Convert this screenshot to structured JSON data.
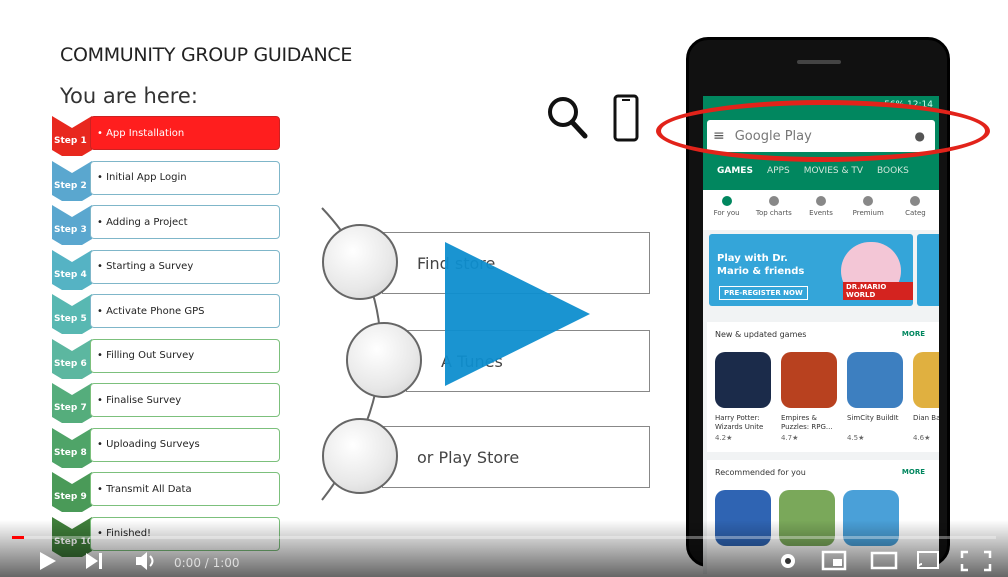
{
  "slide": {
    "title": "COMMUNITY GROUP GUIDANCE",
    "subtitle": "You are here:",
    "steps": [
      {
        "num": "Step 1",
        "label": "• App Installation",
        "color": "#e8281e",
        "state": "active"
      },
      {
        "num": "Step 2",
        "label": "• Initial App Login",
        "color": "#5aa7cf",
        "state": "blue"
      },
      {
        "num": "Step 3",
        "label": "• Adding a Project",
        "color": "#5aa7cf",
        "state": "blue"
      },
      {
        "num": "Step 4",
        "label": "• Starting a Survey",
        "color": "#55b3c4",
        "state": "blue"
      },
      {
        "num": "Step 5",
        "label": "• Activate Phone GPS",
        "color": "#58b8b2",
        "state": "blue"
      },
      {
        "num": "Step 6",
        "label": "• Filling Out Survey",
        "color": "#5cb7a0",
        "state": "green"
      },
      {
        "num": "Step 7",
        "label": "• Finalise Survey",
        "color": "#55ad7c",
        "state": "green"
      },
      {
        "num": "Step 8",
        "label": "• Uploading Surveys",
        "color": "#4fa468",
        "state": "green"
      },
      {
        "num": "Step 9",
        "label": "• Transmit All Data",
        "color": "#4a9a58",
        "state": "green"
      },
      {
        "num": "Step 10",
        "label": "• Finished!",
        "color": "#3f7f3a",
        "state": "green"
      }
    ],
    "options": [
      {
        "label": "Find store"
      },
      {
        "label": "A Tunes"
      },
      {
        "label": "or Play Store"
      }
    ],
    "icons": [
      "search-icon",
      "phone-icon"
    ]
  },
  "phone": {
    "status": "56% 12:14",
    "search_placeholder": "Google Play",
    "tabs": [
      "GAMES",
      "APPS",
      "MOVIES & TV",
      "BOOKS"
    ],
    "subnav": [
      "For you",
      "Top charts",
      "Events",
      "Premium",
      "Categ"
    ],
    "banner": {
      "text": "Play with Dr. Mario & friends",
      "button": "PRE-REGISTER NOW",
      "tag": "DR.MARIO WORLD"
    },
    "section1": {
      "title": "New & updated games",
      "more": "MORE"
    },
    "apps": [
      {
        "name": "Harry Potter: Wizards Unite",
        "rating": "4.2★",
        "color": "#1b2b4a"
      },
      {
        "name": "Empires & Puzzles: RPG...",
        "rating": "4.7★",
        "color": "#b8411f"
      },
      {
        "name": "SimCity BuildIt",
        "rating": "4.5★",
        "color": "#3d7fc0"
      },
      {
        "name": "Dian Battl",
        "rating": "4.6★",
        "color": "#e0b040"
      }
    ],
    "section2": {
      "title": "Recommended for you",
      "more": "MORE"
    }
  },
  "player": {
    "time": "0:00 / 1:00",
    "progress": 0.0,
    "accent": "#ff0000"
  }
}
